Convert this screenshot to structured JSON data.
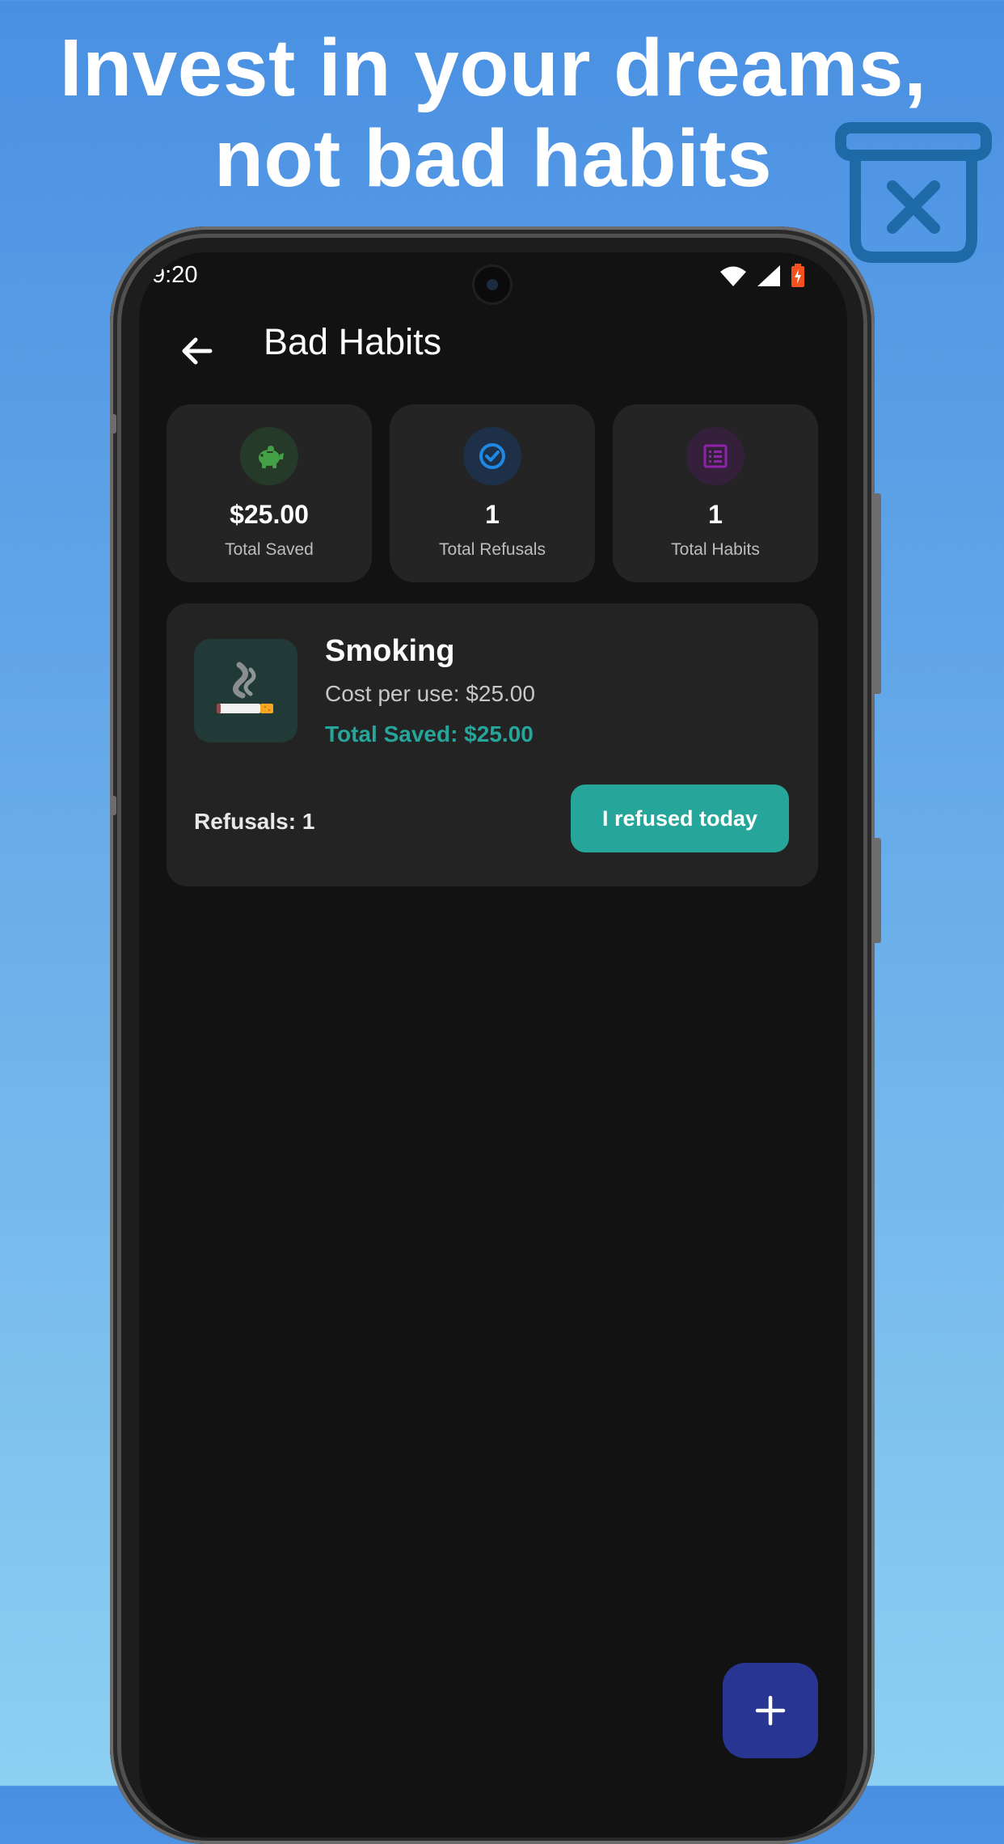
{
  "promo": {
    "headline_line1": "Invest in your dreams,",
    "headline_line2": "not bad habits",
    "icon": "trash-x-icon",
    "icon_color": "#1e6aa6"
  },
  "status_bar": {
    "time": "9:20",
    "icons": [
      "wifi-icon",
      "signal-icon",
      "battery-charging-icon"
    ]
  },
  "app_bar": {
    "back_icon": "arrow-left-icon",
    "title": "Bad Habits"
  },
  "stats": [
    {
      "icon": "piggy-bank-icon",
      "icon_color": "#43a047",
      "value": "$25.00",
      "label": "Total Saved"
    },
    {
      "icon": "check-circle-icon",
      "icon_color": "#1e88e5",
      "value": "1",
      "label": "Total Refusals"
    },
    {
      "icon": "list-icon",
      "icon_color": "#8e24aa",
      "value": "1",
      "label": "Total Habits"
    }
  ],
  "habits": [
    {
      "emoji": "🚬",
      "name": "Smoking",
      "cost": "Cost per use: $25.00",
      "total_saved": "Total Saved: $25.00",
      "refusals": "Refusals: 1",
      "action_label": "I refused today"
    }
  ],
  "fab": {
    "icon": "plus-icon",
    "color": "#283593"
  },
  "colors": {
    "accent": "#26a69a",
    "background": "#121212",
    "card": "#242424"
  }
}
